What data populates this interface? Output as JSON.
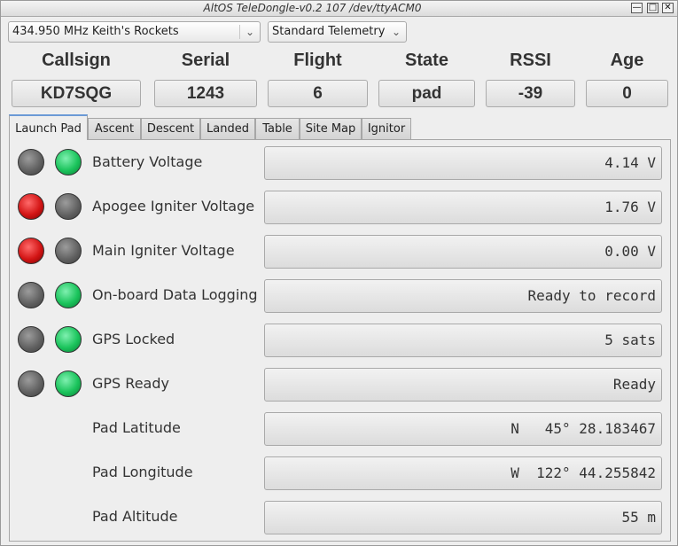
{
  "window": {
    "title": "AltOS TeleDongle-v0.2 107 /dev/ttyACM0"
  },
  "controls": {
    "frequency": "434.950 MHz Keith's Rockets",
    "telemetry": "Standard Telemetry"
  },
  "headers": [
    {
      "label": "Callsign",
      "value": "KD7SQG"
    },
    {
      "label": "Serial",
      "value": "1243"
    },
    {
      "label": "Flight",
      "value": "6"
    },
    {
      "label": "State",
      "value": "pad"
    },
    {
      "label": "RSSI",
      "value": "-39"
    },
    {
      "label": "Age",
      "value": "0"
    }
  ],
  "tabs": [
    "Launch Pad",
    "Ascent",
    "Descent",
    "Landed",
    "Table",
    "Site Map",
    "Ignitor"
  ],
  "rows": [
    {
      "label": "Battery Voltage",
      "value": "4.14 V",
      "led1": "gray",
      "led2": "green"
    },
    {
      "label": "Apogee Igniter Voltage",
      "value": "1.76 V",
      "led1": "red",
      "led2": "gray"
    },
    {
      "label": "Main Igniter Voltage",
      "value": "0.00 V",
      "led1": "red",
      "led2": "gray"
    },
    {
      "label": "On-board Data Logging",
      "value": "Ready to record",
      "led1": "gray",
      "led2": "green"
    },
    {
      "label": "GPS Locked",
      "value": "5 sats",
      "led1": "gray",
      "led2": "green"
    },
    {
      "label": "GPS Ready",
      "value": "Ready",
      "led1": "gray",
      "led2": "green"
    },
    {
      "label": "Pad Latitude",
      "value": "N   45° 28.183467"
    },
    {
      "label": "Pad Longitude",
      "value": "W  122° 44.255842"
    },
    {
      "label": "Pad Altitude",
      "value": "55 m"
    }
  ],
  "colors": {
    "led_green": "#1bc45c",
    "led_red": "#d31515",
    "led_gray": "#5e5e5e",
    "tab_accent": "#6b9ad6"
  }
}
